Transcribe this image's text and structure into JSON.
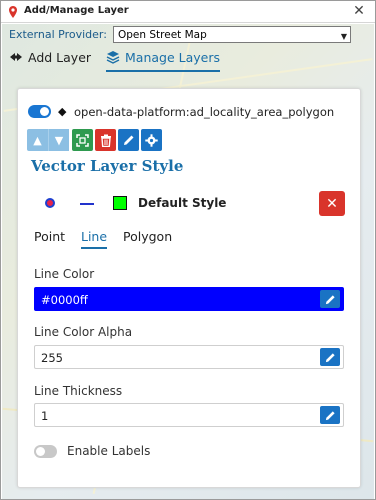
{
  "window": {
    "title": "Add/Manage Layer",
    "close_glyph": "✕"
  },
  "provider": {
    "label": "External Provider:",
    "selected": "Open Street Map"
  },
  "top_tabs": {
    "add_label": "Add Layer",
    "manage_label": "Manage Layers",
    "active": "Manage Layers"
  },
  "layer": {
    "enabled": true,
    "name": "open-data-platform:ad_locality_area_polygon"
  },
  "toolbar": {
    "icons": [
      "up-icon",
      "down-icon",
      "zoom-extent-icon",
      "trash-icon",
      "pencil-icon",
      "gear-icon"
    ]
  },
  "vector_style": {
    "heading": "Vector Layer Style",
    "style_name": "Default Style",
    "point_fill_color": "#e8234a",
    "point_stroke_color": "#1f3fcf",
    "line_color": "#2233cc",
    "polygon_fill_color": "#00ff00"
  },
  "geometry_tabs": {
    "point": "Point",
    "line": "Line",
    "polygon": "Polygon",
    "active": "Line"
  },
  "fields": {
    "line_color_label": "Line Color",
    "line_color_value": "#0000ff",
    "line_color_alpha_label": "Line Color Alpha",
    "line_color_alpha_value": "255",
    "line_thickness_label": "Line Thickness",
    "line_thickness_value": "1"
  },
  "labels": {
    "enabled": false,
    "text": "Enable Labels"
  },
  "colors": {
    "accent": "#1a6fa8",
    "primary_button": "#1a73c4",
    "danger": "#d9342b",
    "success": "#2e9a4f"
  }
}
